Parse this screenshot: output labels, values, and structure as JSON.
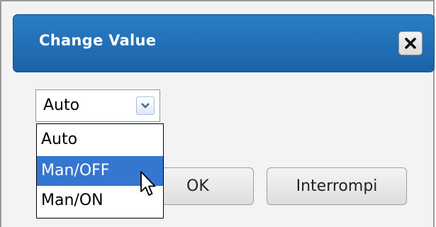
{
  "dialog": {
    "title": "Change Value",
    "close_icon": "close-x-icon"
  },
  "select": {
    "value": "Auto",
    "arrow_icon": "chevron-down-icon",
    "options": [
      "Auto",
      "Man/OFF",
      "Man/ON"
    ],
    "highlighted_index": 1
  },
  "buttons": {
    "ok_label": "OK",
    "cancel_label": "Interrompi"
  },
  "colors": {
    "titlebar": "#1b62a8",
    "highlight": "#3576d0"
  }
}
